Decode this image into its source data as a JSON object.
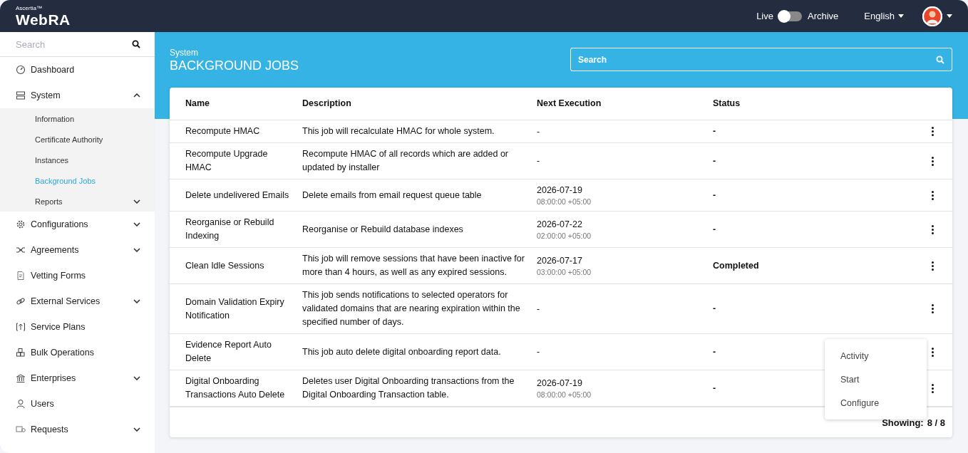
{
  "header": {
    "brand_small": "Ascertia™",
    "brand": "WebRA",
    "live_label": "Live",
    "archive_label": "Archive",
    "archive_on": false,
    "language": "English"
  },
  "sidebar": {
    "search": {
      "placeholder": "Search"
    },
    "items": [
      {
        "label": "Dashboard"
      },
      {
        "label": "System",
        "expanded": true,
        "children": [
          {
            "label": "Information",
            "selected": false
          },
          {
            "label": "Certificate Authority",
            "selected": false
          },
          {
            "label": "Instances",
            "selected": false
          },
          {
            "label": "Background Jobs",
            "selected": true
          },
          {
            "label": "Reports",
            "selected": false,
            "expanded": false
          }
        ]
      },
      {
        "label": "Configurations",
        "expanded": false
      },
      {
        "label": "Agreements",
        "expanded": false
      },
      {
        "label": "Vetting Forms"
      },
      {
        "label": "External Services",
        "expanded": false
      },
      {
        "label": "Service Plans"
      },
      {
        "label": "Bulk Operations"
      },
      {
        "label": "Enterprises",
        "expanded": false
      },
      {
        "label": "Users"
      },
      {
        "label": "Requests",
        "expanded": false
      }
    ]
  },
  "page": {
    "breadcrumb": "System",
    "title": "BACKGROUND JOBS",
    "search": {
      "placeholder": "Search"
    }
  },
  "table": {
    "columns": [
      "Name",
      "Description",
      "Next Execution",
      "Status"
    ],
    "rows": [
      {
        "name": "Recompute HMAC",
        "description": "This job will recalculate HMAC for whole system.",
        "next_date": "-",
        "status": "-"
      },
      {
        "name": "Recompute Upgrade HMAC",
        "description": "Recompute HMAC of all records which are added or updated by installer",
        "next_date": "-",
        "status": "-"
      },
      {
        "name": "Delete undelivered Emails",
        "description": "Delete emails from email request queue table",
        "next_date": "2026-07-19",
        "next_time": "08:00:00 +05:00",
        "status": "-"
      },
      {
        "name": "Reorganise or Rebuild Indexing",
        "description": "Reorganise or Rebuild database indexes",
        "next_date": "2026-07-22",
        "next_time": "02:00:00 +05:00",
        "status": "-"
      },
      {
        "name": "Clean Idle Sessions",
        "description": "This job will remove sessions that have been inactive for more than 4 hours, as well as any expired sessions.",
        "next_date": "2026-07-17",
        "next_time": "03:00:00 +05:00",
        "status": "Completed"
      },
      {
        "name": "Domain Validation Expiry Notification",
        "description": "This job sends notifications to selected operators for validated domains that are nearing expiration within the specified number of days.",
        "next_date": "-",
        "status": "-"
      },
      {
        "name": "Evidence Report Auto Delete",
        "description": "This job auto delete digital onboarding report data.",
        "next_date": "-",
        "status": "-"
      },
      {
        "name": "Digital Onboarding Transactions Auto Delete",
        "description": "Deletes user Digital Onboarding transactions from the Digital Onboarding Transaction table.",
        "next_date": "2026-07-19",
        "next_time": "08:00:00 +05:00",
        "status": "-"
      }
    ],
    "footer_label": "Showing:",
    "footer_count": "8 / 8"
  },
  "context_menu": {
    "items": [
      "Activity",
      "Start",
      "Configure"
    ]
  }
}
